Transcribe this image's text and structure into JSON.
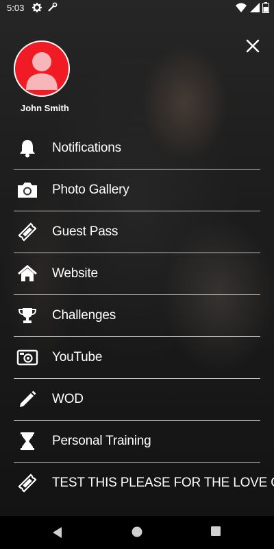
{
  "status_bar": {
    "time": "5:03",
    "icons": [
      "gear-icon",
      "wrench-icon",
      "wifi-icon",
      "battery-icon"
    ]
  },
  "drawer": {
    "close_icon": "close-icon",
    "user": {
      "name": "John Smith",
      "avatar_color": "#f01b24"
    },
    "items": [
      {
        "label": "Notifications",
        "icon": "bell-icon"
      },
      {
        "label": "Photo Gallery",
        "icon": "camera-icon"
      },
      {
        "label": "Guest Pass",
        "icon": "ticket-icon"
      },
      {
        "label": "Website",
        "icon": "home-icon"
      },
      {
        "label": "Challenges",
        "icon": "trophy-icon"
      },
      {
        "label": "YouTube",
        "icon": "video-camera-icon"
      },
      {
        "label": "WOD",
        "icon": "pencil-icon"
      },
      {
        "label": "Personal Training",
        "icon": "hourglass-icon"
      },
      {
        "label": "TEST THIS PLEASE FOR THE LOVE OF GOD",
        "icon": "ticket-icon"
      }
    ]
  },
  "nav_bar": {
    "buttons": [
      "back-icon",
      "home-circle-icon",
      "recents-icon"
    ]
  }
}
